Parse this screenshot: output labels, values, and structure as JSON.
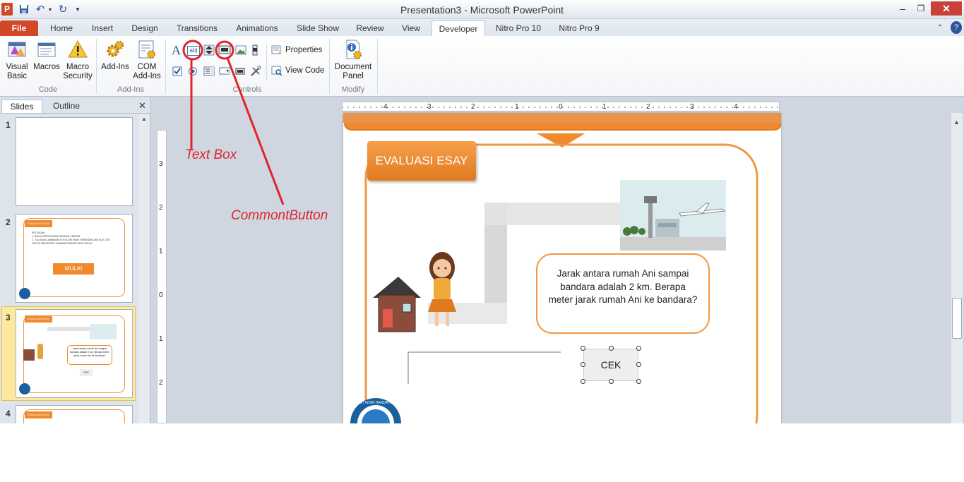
{
  "window": {
    "title": "Presentation3 - Microsoft PowerPoint"
  },
  "tabs": [
    {
      "label": "File"
    },
    {
      "label": "Home"
    },
    {
      "label": "Insert"
    },
    {
      "label": "Design"
    },
    {
      "label": "Transitions"
    },
    {
      "label": "Animations"
    },
    {
      "label": "Slide Show"
    },
    {
      "label": "Review"
    },
    {
      "label": "View"
    },
    {
      "label": "Developer"
    },
    {
      "label": "Nitro Pro 10"
    },
    {
      "label": "Nitro Pro 9"
    }
  ],
  "ribbon": {
    "code": {
      "visual_basic": "Visual Basic",
      "macros": "Macros",
      "macro_security": "Macro Security",
      "group": "Code"
    },
    "addins": {
      "add_ins": "Add-Ins",
      "com_add_ins": "COM Add-Ins",
      "group": "Add-Ins"
    },
    "controls": {
      "properties": "Properties",
      "view_code": "View Code",
      "group": "Controls"
    },
    "modify": {
      "document_panel": "Document Panel",
      "group": "Modify"
    }
  },
  "panes": {
    "slides_tab": "Slides",
    "outline_tab": "Outline"
  },
  "thumbnails": [
    {
      "num": "1"
    },
    {
      "num": "2",
      "tag": "EVALUASI ESAY",
      "lines": [
        "PETUNJUK :",
        "1. BACA PERTANYAAN DENGAN CERMAT",
        "2. TULISKAN JAWABAN DI KOLOM YANG TERSEDIA DAN KLIK CEK",
        "UNTUK MENGECEK JAWABAN BENAR ATAU SALAH"
      ],
      "button": "MULAI"
    },
    {
      "num": "3",
      "tag": "EVALUASI ESAY",
      "text": "Jarak antara rumah Ani sampai bandara adalah 2 km. Berapa meter jarak rumah Ani ke bandara?",
      "button": "CEK"
    },
    {
      "num": "4",
      "tag": "EVALUASI ESAY"
    }
  ],
  "ruler": {
    "labels": [
      "4",
      "3",
      "2",
      "1",
      "0",
      "1",
      "2",
      "3",
      "4"
    ],
    "vlabels": [
      "3",
      "2",
      "1",
      "0",
      "1",
      "2"
    ]
  },
  "slide": {
    "tag": "EVALUASI ESAY",
    "question": "Jarak antara rumah Ani sampai bandara adalah 2 km. Berapa meter jarak rumah Ani ke bandara?",
    "button": "CEK",
    "logo_text": "TUT WURI HANDAYANI"
  },
  "annotations": {
    "text_box": "Text Box",
    "command_button": "CommontButton",
    "color": "#e0242d"
  },
  "colors": {
    "accent": "#f08a2c",
    "file_tab": "#d24726"
  }
}
